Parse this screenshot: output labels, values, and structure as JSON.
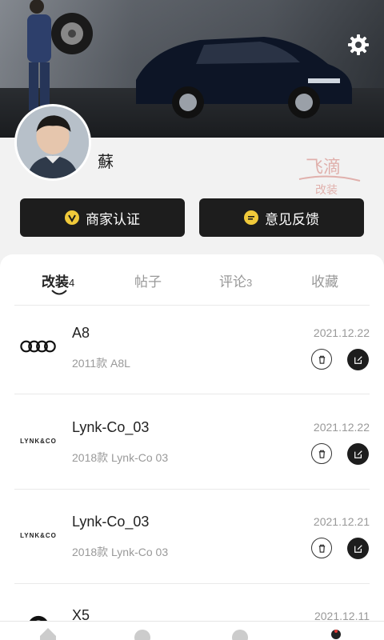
{
  "profile": {
    "username": "蘇",
    "watermark_top": "飞滴",
    "watermark_bottom": "改装"
  },
  "actions": {
    "merchant_label": "商家认证",
    "merchant_icon": "v-badge-icon",
    "feedback_label": "意见反馈",
    "feedback_icon": "chat-icon"
  },
  "tabs": [
    {
      "label": "改装",
      "count": "4"
    },
    {
      "label": "帖子",
      "count": ""
    },
    {
      "label": "评论",
      "count": "3"
    },
    {
      "label": "收藏",
      "count": ""
    }
  ],
  "items": [
    {
      "name": "A8",
      "spec": "2011款 A8L",
      "date": "2021.12.22",
      "brand": "audi"
    },
    {
      "name": "Lynk-Co_03",
      "spec": "2018款 Lynk-Co 03",
      "date": "2021.12.22",
      "brand": "lynk",
      "brand_text": "LYNK&CO"
    },
    {
      "name": "Lynk-Co_03",
      "spec": "2018款 Lynk-Co 03",
      "date": "2021.12.21",
      "brand": "lynk",
      "brand_text": "LYNK&CO"
    },
    {
      "name": "X5",
      "spec": "",
      "date": "2021.12.11",
      "brand": "bmw"
    }
  ],
  "colors": {
    "accent": "#f0c93a",
    "dark_button": "#1d1d1d"
  }
}
